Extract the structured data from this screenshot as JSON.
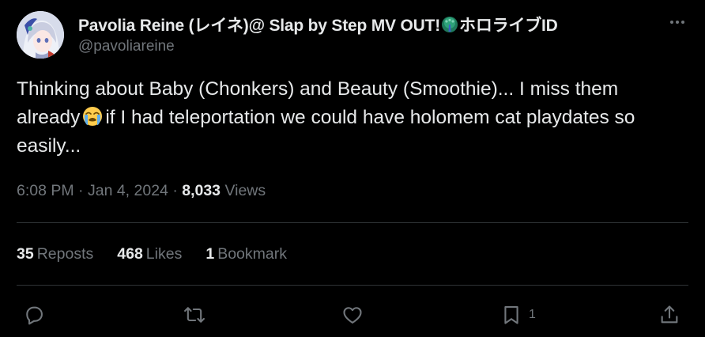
{
  "author": {
    "display_name_prefix": "Pavolia Reine (レイネ)@ Slap by Step MV OUT!",
    "display_name_suffix": "ホロライブID",
    "handle": "@pavoliareine",
    "name_emoji_icon": "peacock-icon"
  },
  "tweet": {
    "text_part1": "Thinking about Baby (Chonkers) and Beauty (Smoothie)... I miss them already",
    "text_emoji_icon": "loudly-crying-face-icon",
    "text_part2": "if I had teleportation we could have holomem cat playdates so easily...",
    "time": "6:08 PM",
    "separator": "·",
    "date": "Jan 4, 2024",
    "views_count": "8,033",
    "views_label": "Views"
  },
  "stats": {
    "reposts_count": "35",
    "reposts_label": "Reposts",
    "likes_count": "468",
    "likes_label": "Likes",
    "bookmarks_count": "1",
    "bookmarks_label": "Bookmark"
  },
  "actions": {
    "reply_icon": "reply-icon",
    "repost_icon": "repost-icon",
    "like_icon": "heart-icon",
    "bookmark_icon": "bookmark-icon",
    "bookmark_count": "1",
    "share_icon": "share-icon",
    "more_icon": "more-dots-icon"
  },
  "colors": {
    "background": "#000000",
    "primary_text": "#e7e9ea",
    "secondary_text": "#71767b",
    "divider": "#2f3336"
  }
}
